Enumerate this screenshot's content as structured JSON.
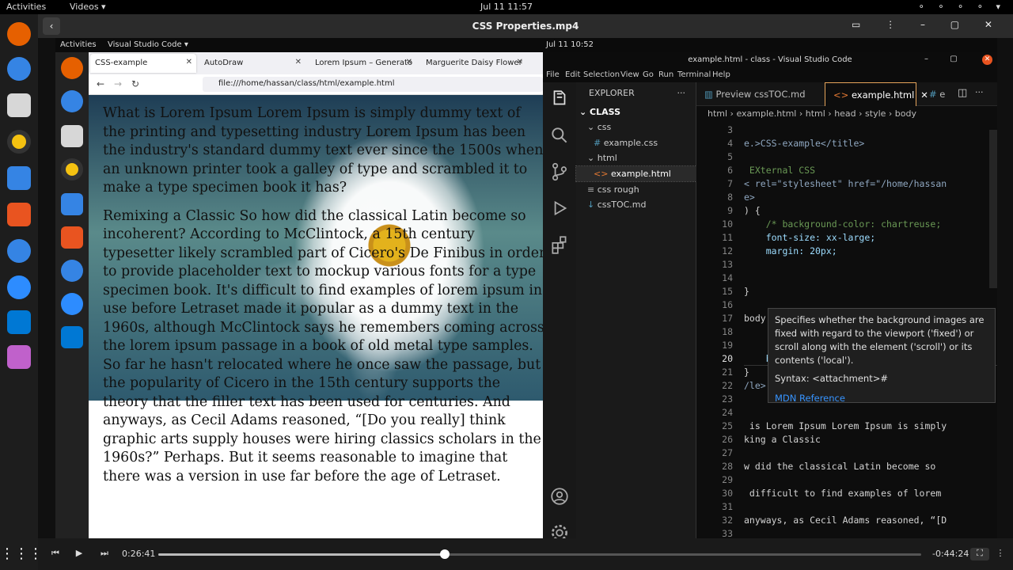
{
  "top_bar": {
    "activities": "Activities",
    "app_menu": "Videos ▾",
    "clock": "Jul 11  11:57",
    "status_icons": "⚬ ⚬ ⚬ ⚬ ▾"
  },
  "player": {
    "title": "CSS Properties.mp4",
    "back_icon": "‹",
    "elapsed": "0:26:41",
    "remaining": "-0:44:24",
    "progress": 0.375
  },
  "inner_top_bar": {
    "activities": "Activities",
    "app_menu": "Visual Studio Code ▾",
    "clock": "Jul 11  10:52"
  },
  "firefox": {
    "tabs": [
      {
        "label": "CSS-example"
      },
      {
        "label": "AutoDraw"
      },
      {
        "label": "Lorem Ipsum – Generato"
      },
      {
        "label": "Marguerite Daisy Flower"
      }
    ],
    "url": "file:///home/hassan/class/html/example.html",
    "paragraphs": [
      "What is Lorem Ipsum Lorem Ipsum is simply dummy text of the printing and typesetting industry Lorem Ipsum has been the industry's standard dummy text ever since the 1500s when an unknown printer took a galley of type and scrambled it to make a type specimen book it has?",
      "Remixing a Classic So how did the classical Latin become so incoherent? According to McClintock, a 15th century typesetter likely scrambled part of Cicero's De Finibus in order to provide placeholder text to mockup various fonts for a type specimen book. It's difficult to find examples of lorem ipsum in use before Letraset made it popular as a dummy text in the 1960s, although McClintock says he remembers coming across the lorem ipsum passage in a book of old metal type samples. So far he hasn't relocated where he once saw the passage, but the popularity of Cicero in the 15th century supports the theory that the filler text has been used for centuries. And anyways, as Cecil Adams reasoned, “[Do you really] think graphic arts supply houses were hiring classics scholars in the 1960s?” Perhaps. But it seems reasonable to imagine that there was a version in use far before the age of Letraset."
    ]
  },
  "vscode": {
    "window_title": "example.html - class - Visual Studio Code",
    "menu": [
      "File",
      "Edit",
      "Selection",
      "View",
      "Go",
      "Run",
      "Terminal",
      "Help"
    ],
    "explorer": {
      "header": "EXPLORER",
      "root": "CLASS",
      "items": [
        {
          "label": "css",
          "kind": "folder"
        },
        {
          "label": "example.css",
          "kind": "css"
        },
        {
          "label": "html",
          "kind": "folder"
        },
        {
          "label": "example.html",
          "kind": "html"
        },
        {
          "label": "css rough",
          "kind": "file"
        },
        {
          "label": "cssTOC.md",
          "kind": "md"
        }
      ]
    },
    "tabs": [
      {
        "label": "Preview cssTOC.md"
      },
      {
        "label": "example.html"
      },
      {
        "label": "e"
      }
    ],
    "breadcrumb": "html  ›  example.html  ›  html  ›  head  ›  style  ›  body",
    "line_numbers": [
      "3",
      "4",
      "5",
      "6",
      "7",
      "8",
      "9",
      "10",
      "11",
      "12",
      "13",
      "14",
      "15",
      "16",
      "17",
      "18",
      "19",
      "20",
      "21",
      "22",
      "23",
      "24",
      "25",
      "26",
      "27",
      "28",
      "29",
      "30",
      "31",
      "32",
      "33"
    ],
    "current_line": "20",
    "code_lines": [
      "",
      "e.>CSS-example</title>",
      "",
      " EXternal CSS",
      "< rel=\"stylesheet\" href=\"/home/hassan",
      "e>",
      ") {",
      "    /* background-color: chartreuse;",
      "    font-size: xx-large;",
      "    margin: 20px;",
      "",
      "",
      "}",
      "",
      "body",
      "",
      "",
      "    background-attachment: fixed;",
      "}",
      "/le>",
      "",
      "",
      " is Lorem Ipsum Lorem Ipsum is simply",
      "king a Classic",
      "",
      "w did the classical Latin become so",
      "",
      " difficult to find examples of lorem",
      "",
      "anyways, as Cecil Adams reasoned, “[D",
      ""
    ],
    "hover": {
      "description": "Specifies whether the background images are fixed with regard to the viewport ('fixed') or scroll along with the element ('scroll') or its contents ('local').",
      "syntax": "Syntax: <attachment>#",
      "link": "MDN Reference"
    }
  }
}
